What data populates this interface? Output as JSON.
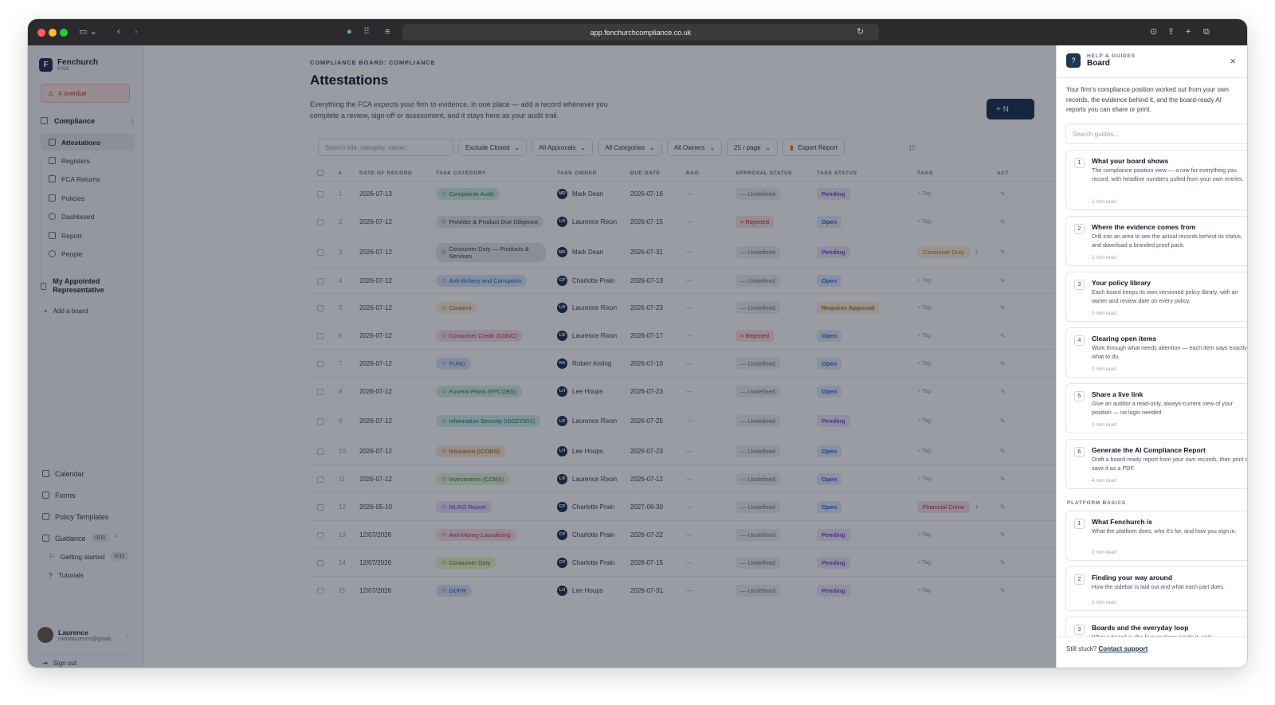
{
  "browser": {
    "url": "app.fenchurchcompliance.co.uk"
  },
  "brand": {
    "name": "Fenchurch",
    "sub": "ONE"
  },
  "overdue": "4 overdue",
  "sidebar": {
    "section": "Compliance",
    "items": [
      "Attestations",
      "Registers",
      "FCA Returns",
      "Policies",
      "Dashboard",
      "Report",
      "People"
    ],
    "rep": "My Appointed Representative",
    "add": "Add a board",
    "bottom": [
      "Calendar",
      "Forms",
      "Policy Templates"
    ],
    "guidance": "Guidance",
    "guidance_count": "0/11",
    "getting": "Getting started",
    "getting_count": "0/11",
    "tutorials": "Tutorials",
    "user_name": "Laurence",
    "user_email": "rixonlaurence@gmail...",
    "signout": "Sign out"
  },
  "page": {
    "crumb": "COMPLIANCE BOARD: COMPLIANCE",
    "title": "Attestations",
    "desc": "Everything the FCA expects your firm to evidence, in one place — add a record whenever you complete a review, sign-off or assessment, and it stays here as your audit trail.",
    "new": "+ N"
  },
  "filters": {
    "search_ph": "Search title, category, owner...",
    "closed": "Exclude Closed",
    "approvals": "All Approvals",
    "categories": "All Categories",
    "owners": "All Owners",
    "perpage": "25 / page",
    "export": "Export Report",
    "count": "15"
  },
  "columns": [
    "#",
    "DATE OF RECORD",
    "TASK CATEGORY",
    "TASK OWNER",
    "DUE DATE",
    "RAG",
    "APPROVAL STATUS",
    "TASK STATUS",
    "TAGS",
    "ACT"
  ],
  "rows": [
    {
      "n": "1",
      "date": "2026-07-13",
      "cat": "Complaints Audit",
      "c": "#d6f2e4",
      "tc": "#1f7a4d",
      "ini": "MD",
      "owner": "Mark Dean",
      "due": "2026-07-16",
      "rag": "—",
      "ap": "— Undefined",
      "at": "u",
      "st": "Pending",
      "sc": "p",
      "tag": "+ Tag"
    },
    {
      "n": "2",
      "date": "2026-07-12",
      "cat": "Provider & Product Due Diligence",
      "c": "#e4e8ec",
      "tc": "#374151",
      "ini": "LR",
      "owner": "Laurence Rixon",
      "due": "2026-07-15",
      "rag": "—",
      "ap": "× Rejected",
      "at": "r",
      "st": "Open",
      "sc": "o",
      "tag": "+ Tag"
    },
    {
      "n": "3",
      "date": "2026-07-12",
      "cat": "Consumer Duty — Products & Services",
      "c": "#e4e8ec",
      "tc": "#374151",
      "ini": "MD",
      "owner": "Mark Dean",
      "due": "2026-07-31",
      "rag": "—",
      "ap": "— Undefined",
      "at": "u",
      "st": "Pending",
      "sc": "p",
      "tag": "Consumer Duty",
      "tagc": "#fdf0d9",
      "tagt": "#b7791f"
    },
    {
      "n": "4",
      "date": "2026-07-12",
      "cat": "Anti-Bribery and Corruption",
      "c": "#dbe7fb",
      "tc": "#2f5fb8",
      "ini": "CP",
      "owner": "Charlotte Prain",
      "due": "2026-07-13",
      "rag": "—",
      "ap": "— Undefined",
      "at": "u",
      "st": "Open",
      "sc": "o",
      "tag": "+ Tag"
    },
    {
      "n": "5",
      "date": "2026-07-12",
      "cat": "Consent",
      "c": "#fdf0d9",
      "tc": "#8a6317",
      "ini": "LR",
      "owner": "Laurence Rixon",
      "due": "2026-07-23",
      "rag": "—",
      "ap": "— Undefined",
      "at": "u",
      "st": "Requires Approval",
      "sc": "a",
      "tag": "+ Tag"
    },
    {
      "n": "6",
      "date": "2026-07-12",
      "cat": "Consumer Credit (CONC)",
      "c": "#fbe0e6",
      "tc": "#b1354f",
      "ini": "LR",
      "owner": "Laurence Rixon",
      "due": "2026-07-17",
      "rag": "—",
      "ap": "× Rejected",
      "at": "r",
      "st": "Open",
      "sc": "o",
      "tag": "+ Tag"
    },
    {
      "n": "7",
      "date": "2026-07-12",
      "cat": "FUND",
      "c": "#dbe7fb",
      "tc": "#2f5fb8",
      "ini": "RA",
      "owner": "Robert Aisling",
      "due": "2026-07-10",
      "rag": "—",
      "ap": "— Undefined",
      "at": "u",
      "st": "Open",
      "sc": "o",
      "tag": "+ Tag"
    },
    {
      "n": "8",
      "date": "2026-07-12",
      "cat": "Funeral Plans (FPCOBS)",
      "c": "#d6f2e4",
      "tc": "#1f7a4d",
      "ini": "LH",
      "owner": "Lee Houps",
      "due": "2026-07-23",
      "rag": "—",
      "ap": "— Undefined",
      "at": "u",
      "st": "Open",
      "sc": "o",
      "tag": "+ Tag"
    },
    {
      "n": "9",
      "date": "2026-07-12",
      "cat": "Information Security (ISO27001)",
      "c": "#d3f1ef",
      "tc": "#1c6f6a",
      "ini": "LR",
      "owner": "Laurence Rixon",
      "due": "2026-07-25",
      "rag": "—",
      "ap": "— Undefined",
      "at": "u",
      "st": "Pending",
      "sc": "p",
      "tag": "+ Tag"
    },
    {
      "n": "10",
      "date": "2026-07-12",
      "cat": "Insurance (ICOBS)",
      "c": "#fde7d4",
      "tc": "#a35a17",
      "ini": "LH",
      "owner": "Lee Houps",
      "due": "2026-07-23",
      "rag": "—",
      "ap": "— Undefined",
      "at": "u",
      "st": "Open",
      "sc": "o",
      "tag": "+ Tag"
    },
    {
      "n": "11",
      "date": "2026-07-12",
      "cat": "Investments (COBS)",
      "c": "#e3f4d6",
      "tc": "#4a7a1f",
      "ini": "LR",
      "owner": "Laurence Rixon",
      "due": "2026-07-12",
      "rag": "—",
      "ap": "— Undefined",
      "at": "u",
      "st": "Open",
      "sc": "o",
      "tag": "+ Tag"
    },
    {
      "n": "12",
      "date": "2026-05-10",
      "cat": "MLRO Report",
      "c": "#ece3fb",
      "tc": "#6a3fbf",
      "ini": "CP",
      "owner": "Charlotte Prain",
      "due": "2027-06-30",
      "rag": "—",
      "ap": "— Undefined",
      "at": "u",
      "st": "Open",
      "sc": "o",
      "tag": "Financial Crime",
      "tagc": "#fbe0e6",
      "tagt": "#b1354f"
    },
    {
      "n": "13",
      "date": "12/07/2026",
      "cat": "Anti-Money Laundering",
      "c": "#fbe0e6",
      "tc": "#b1354f",
      "ini": "CP",
      "owner": "Charlotte Prain",
      "due": "2026-07-22",
      "rag": "—",
      "ap": "— Undefined",
      "at": "u",
      "st": "Pending",
      "sc": "p",
      "tag": "+ Tag"
    },
    {
      "n": "14",
      "date": "12/07/2026",
      "cat": "Consumer Duty",
      "c": "#eef6c9",
      "tc": "#5d6b12",
      "ini": "CP",
      "owner": "Charlotte Prain",
      "due": "2026-07-15",
      "rag": "—",
      "ap": "— Undefined",
      "at": "u",
      "st": "Pending",
      "sc": "p",
      "tag": "+ Tag"
    },
    {
      "n": "15",
      "date": "12/07/2026",
      "cat": "GDPR",
      "c": "#dbe7fb",
      "tc": "#2f5fb8",
      "ini": "LH",
      "owner": "Lee Houps",
      "due": "2026-07-31",
      "rag": "—",
      "ap": "— Undefined",
      "at": "u",
      "st": "Pending",
      "sc": "p",
      "tag": "+ Tag"
    }
  ],
  "panel": {
    "eyebrow": "HELP & GUIDES",
    "title": "Board",
    "desc": "Your firm's compliance position worked out from your own records, the evidence behind it, and the board-ready AI reports you can share or print.",
    "search_ph": "Search guides...",
    "guides": [
      {
        "n": "1",
        "t": "What your board shows",
        "d": "The compliance position view — a row for everything you record, with headline numbers pulled from your own entries.",
        "r": "3 min read"
      },
      {
        "n": "2",
        "t": "Where the evidence comes from",
        "d": "Drill into an area to see the actual records behind its status, and download a branded proof pack.",
        "r": "3 min read"
      },
      {
        "n": "3",
        "t": "Your policy library",
        "d": "Each board keeps its own versioned policy library, with an owner and review date on every policy.",
        "r": "3 min read"
      },
      {
        "n": "4",
        "t": "Clearing open items",
        "d": "Work through what needs attention — each item says exactly what to do.",
        "r": "2 min read"
      },
      {
        "n": "5",
        "t": "Share a live link",
        "d": "Give an auditor a read-only, always-current view of your position — no login needed.",
        "r": "2 min read"
      },
      {
        "n": "6",
        "t": "Generate the AI Compliance Report",
        "d": "Draft a board-ready report from your own records, then print or save it as a PDF.",
        "r": "4 min read"
      }
    ],
    "basics_label": "PLATFORM BASICS",
    "basics": [
      {
        "n": "1",
        "t": "What Fenchurch is",
        "d": "What the platform does, who it's for, and how you sign in.",
        "r": "2 min read"
      },
      {
        "n": "2",
        "t": "Finding your way around",
        "d": "How the sidebar is laid out and what each part does.",
        "r": "3 min read"
      },
      {
        "n": "3",
        "t": "Boards and the everyday loop",
        "d": "What a board is, the four sections inside it, and",
        "r": ""
      }
    ],
    "footer": "Still stuck?",
    "footer_link": "Contact support"
  }
}
